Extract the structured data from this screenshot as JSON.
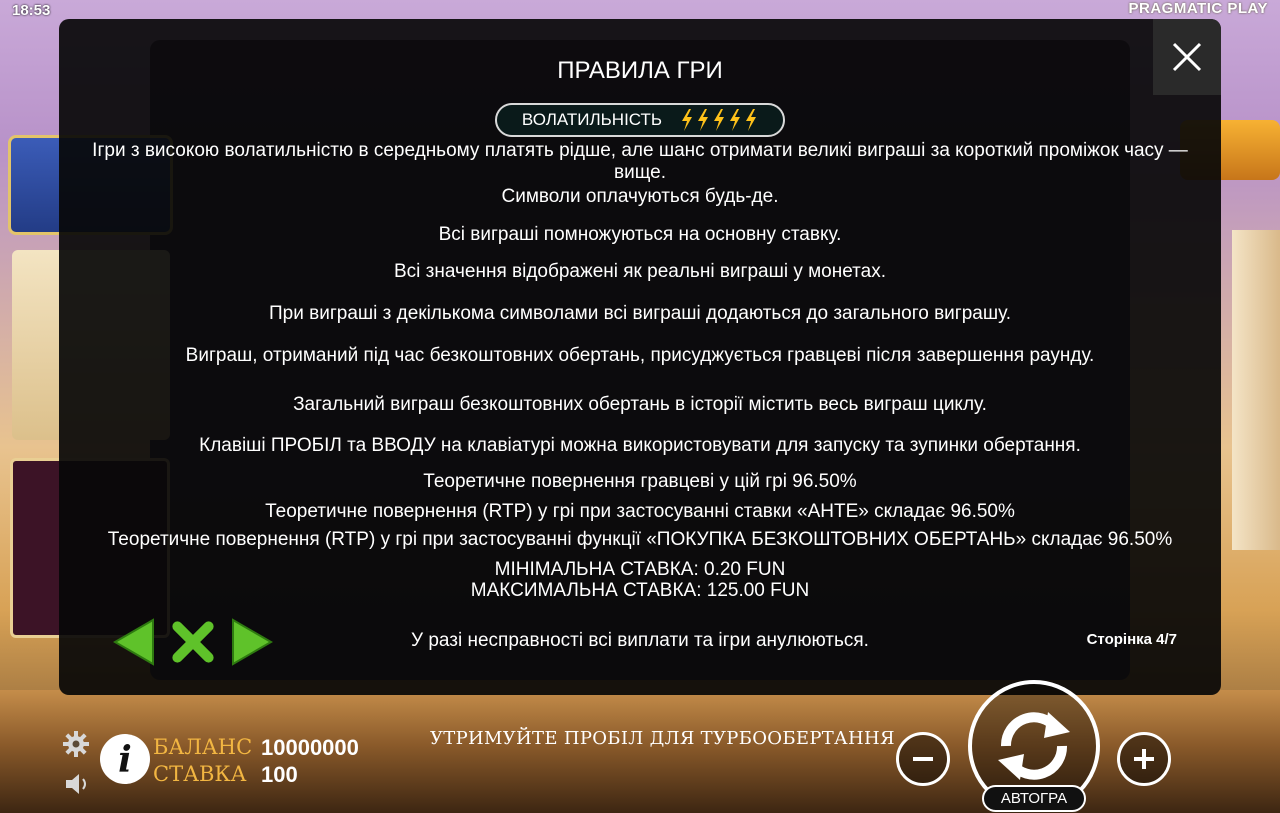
{
  "status": {
    "clock": "18:53",
    "brand": "PRAGMATIC PLAY"
  },
  "modal": {
    "title": "ПРАВИЛА ГРИ",
    "volatility_label": "ВОЛАТИЛЬНІСТЬ",
    "volatility_level": 5,
    "volatility_max": 5,
    "rules": [
      "Ігри з високою волатильністю в середньому платять рідше, але шанс отримати великі виграші за короткий проміжок часу — вище.",
      "Символи оплачуються будь-де.",
      "Всі виграші помножуються на основну ставку.",
      "Всі значення відображені як реальні виграші у монетах.",
      "При виграші з декількома символами всі виграші додаються до загального виграшу.",
      "Виграш, отриманий під час безкоштовних обертань, присуджується гравцеві після завершення раунду.",
      "Загальний виграш безкоштовних обертань в історії містить весь виграш циклу.",
      "Клавіші ПРОБІЛ та ВВОДУ на клавіатурі можна використовувати для запуску та зупинки обертання.",
      "Теоретичне повернення гравцеві у цій грі 96.50%",
      "Теоретичне повернення (RTP) у грі при застосуванні ставки «АНТЕ» складає 96.50%",
      "Теоретичне повернення (RTP) у грі при застосуванні функції «ПОКУПКА БЕЗКОШТОВНИХ ОБЕРТАНЬ» складає 96.50%",
      "МІНІМАЛЬНА СТАВКА: 0.20 FUN",
      "МАКСИМАЛЬНА СТАВКА: 125.00 FUN",
      "У разі несправності всі виплати та ігри анулюються."
    ],
    "page_indicator": "Сторінка 4/7"
  },
  "bottom_bar": {
    "balance_label": "БАЛАНС",
    "balance_value": "10000000",
    "bet_label": "СТАВКА",
    "bet_value": "100",
    "hint": "УТРИМУЙТЕ ПРОБІЛ ДЛЯ ТУРБООБЕРТАННЯ",
    "autoplay_label": "АВТОГРА",
    "info_glyph": "i"
  },
  "colors": {
    "accent_gold": "#f2b642",
    "nav_green": "#5fc22a",
    "bolt_yellow": "#ffc21a"
  }
}
